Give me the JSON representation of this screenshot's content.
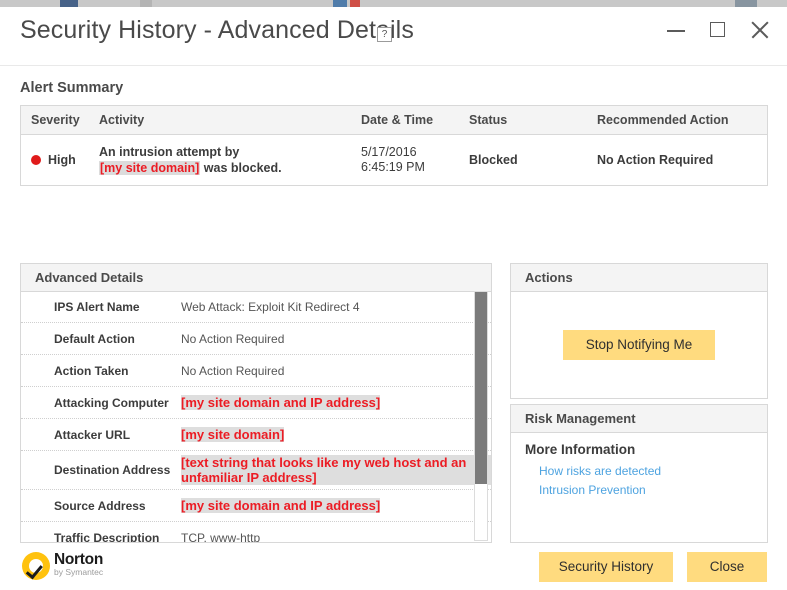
{
  "window": {
    "title": "Security History - Advanced Details",
    "help_label": "?",
    "controls": {
      "minimize": "minimize-icon",
      "maximize": "maximize-icon",
      "close": "close-icon"
    }
  },
  "alert_summary": {
    "heading": "Alert Summary",
    "columns": [
      "Severity",
      "Activity",
      "Date & Time",
      "Status",
      "Recommended Action"
    ],
    "row": {
      "severity": "High",
      "severity_color": "#e01b1b",
      "activity_line1": "An intrusion attempt by",
      "activity_redacted": "[my site domain]",
      "activity_line2_tail": " was blocked.",
      "date": "5/17/2016",
      "time": "6:45:19 PM",
      "status": "Blocked",
      "recommended_action": "No Action Required"
    }
  },
  "advanced_details": {
    "title": "Advanced Details",
    "rows": [
      {
        "label": "IPS Alert Name",
        "value": "Web Attack: Exploit Kit Redirect 4",
        "redacted": false
      },
      {
        "label": "Default Action",
        "value": "No Action Required",
        "redacted": false
      },
      {
        "label": "Action Taken",
        "value": "No Action Required",
        "redacted": false
      },
      {
        "label": "Attacking Computer",
        "value": "[my site domain and IP address]",
        "redacted": true
      },
      {
        "label": "Attacker URL",
        "value": "[my site domain]",
        "redacted": true
      },
      {
        "label": "Destination Address",
        "value": "[text string that looks like my web host and an unfamiliar IP address]",
        "redacted": true
      },
      {
        "label": "Source Address",
        "value": "[my site domain and IP address]",
        "redacted": true
      },
      {
        "label": "Traffic Description",
        "value": "TCP, www-http",
        "redacted": false
      }
    ]
  },
  "actions": {
    "title": "Actions",
    "stop_notifying_label": "Stop Notifying Me"
  },
  "risk_management": {
    "title": "Risk Management",
    "subheading": "More Information",
    "links": [
      "How risks are detected",
      "Intrusion Prevention"
    ]
  },
  "footer": {
    "brand_name": "Norton",
    "brand_tagline": "by Symantec",
    "security_history_label": "Security History",
    "close_label": "Close"
  },
  "colors": {
    "accent_button": "#ffdb7f",
    "redaction_text": "#ec1c24",
    "link": "#4da3e0",
    "panel_header_bg": "#f4f4f4",
    "brand_yellow": "#ffc20e"
  }
}
